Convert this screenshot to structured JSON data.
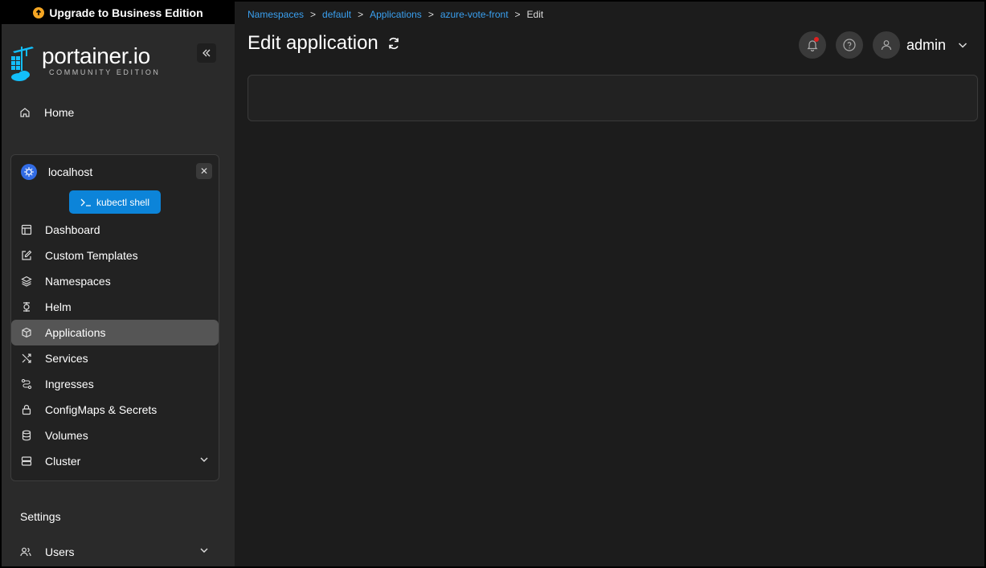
{
  "upgrade_banner": {
    "label": "Upgrade to Business Edition"
  },
  "logo": {
    "name": "portainer.io",
    "edition": "COMMUNITY EDITION"
  },
  "sidebar": {
    "home_label": "Home",
    "environment": {
      "name": "localhost",
      "shell_button": "kubectl shell"
    },
    "items": [
      {
        "label": "Dashboard",
        "icon": "dashboard-icon"
      },
      {
        "label": "Custom Templates",
        "icon": "edit-icon"
      },
      {
        "label": "Namespaces",
        "icon": "layers-icon"
      },
      {
        "label": "Helm",
        "icon": "helm-icon"
      },
      {
        "label": "Applications",
        "icon": "box-icon",
        "active": true
      },
      {
        "label": "Services",
        "icon": "shuffle-icon"
      },
      {
        "label": "Ingresses",
        "icon": "route-icon"
      },
      {
        "label": "ConfigMaps & Secrets",
        "icon": "lock-icon"
      },
      {
        "label": "Volumes",
        "icon": "database-icon"
      },
      {
        "label": "Cluster",
        "icon": "server-icon",
        "expandable": true
      }
    ],
    "settings_label": "Settings",
    "users_label": "Users"
  },
  "breadcrumb": {
    "items": [
      "Namespaces",
      "default",
      "Applications",
      "azure-vote-front"
    ],
    "current": "Edit",
    "separator": ">"
  },
  "header": {
    "title": "Edit application",
    "user": "admin"
  },
  "colors": {
    "accent": "#0c84d9",
    "link": "#3aa0f0",
    "sidebar_bg": "#2a2a2a",
    "main_bg": "#1c1c1c",
    "active_item": "#555555",
    "notification_dot": "#e02020"
  }
}
